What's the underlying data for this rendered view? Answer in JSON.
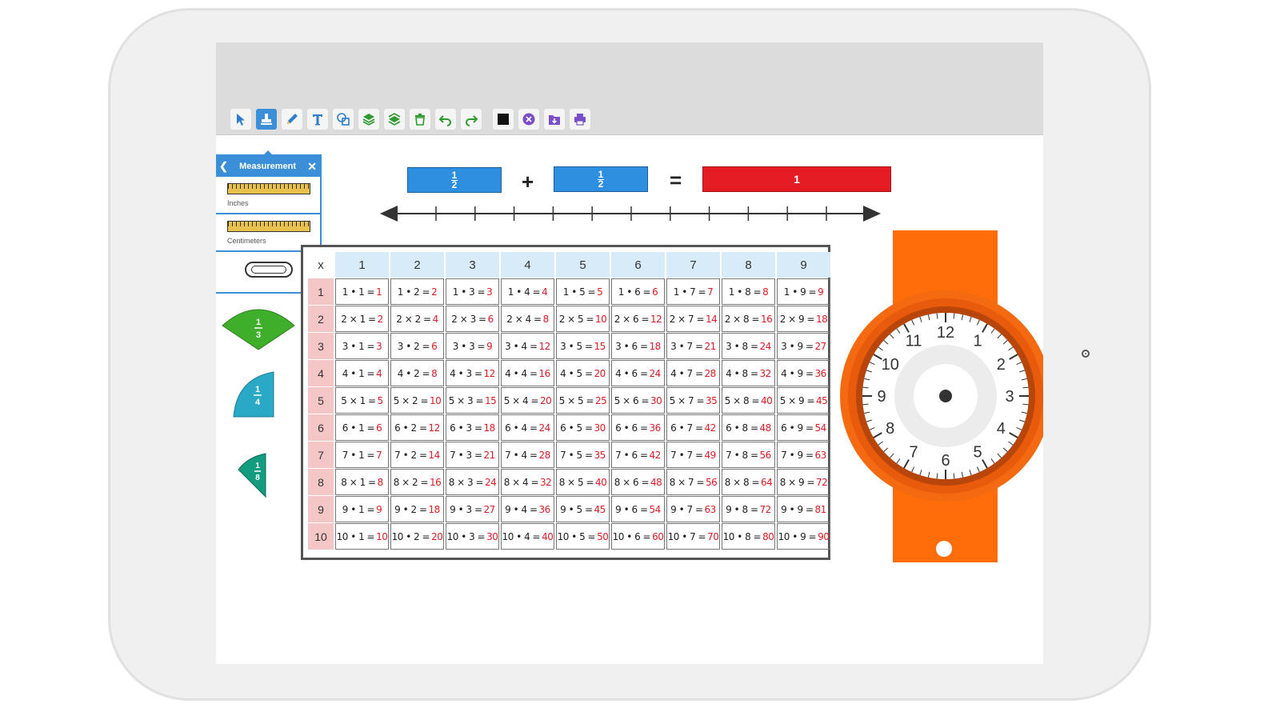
{
  "toolbar": {
    "tools": [
      {
        "name": "select-tool",
        "icon": "pointer-icon"
      },
      {
        "name": "stamp-tool",
        "icon": "stamp-icon",
        "active": true
      },
      {
        "name": "pen-tool",
        "icon": "pencil-icon"
      },
      {
        "name": "text-tool",
        "icon": "text-icon",
        "label": "T"
      },
      {
        "name": "shapes-tool",
        "icon": "shapes-icon"
      },
      {
        "name": "layer-up-tool",
        "icon": "layers-up-icon"
      },
      {
        "name": "layer-down-tool",
        "icon": "layers-down-icon"
      },
      {
        "name": "delete-tool",
        "icon": "trash-icon"
      },
      {
        "name": "undo-tool",
        "icon": "undo-icon"
      },
      {
        "name": "redo-tool",
        "icon": "redo-icon"
      },
      {
        "name": "background-tool",
        "icon": "black-square-icon"
      },
      {
        "name": "clear-tool",
        "icon": "close-circle-icon"
      },
      {
        "name": "save-tool",
        "icon": "save-folder-icon"
      },
      {
        "name": "print-tool",
        "icon": "print-icon"
      }
    ]
  },
  "panel": {
    "title": "Measurement",
    "items": [
      {
        "label": "Inches"
      },
      {
        "label": "Centimeters"
      }
    ]
  },
  "equation": {
    "frac1": {
      "num": "1",
      "den": "2"
    },
    "plus": "+",
    "frac2": {
      "num": "1",
      "den": "2"
    },
    "equals": "=",
    "result": "1"
  },
  "wedges": [
    {
      "num": "1",
      "den": "3",
      "color": "#3fae2a"
    },
    {
      "num": "1",
      "den": "4",
      "color": "#2aa9c6"
    },
    {
      "num": "1",
      "den": "8",
      "color": "#139c7f"
    }
  ],
  "table": {
    "corner": "x",
    "columns": [
      "1",
      "2",
      "3",
      "4",
      "5",
      "6",
      "7",
      "8",
      "9"
    ],
    "rows": [
      "1",
      "2",
      "3",
      "4",
      "5",
      "6",
      "7",
      "8",
      "9",
      "10"
    ],
    "cells": [
      [
        "1 • 1 =",
        "1",
        "1 • 2 =",
        "2",
        "1 • 3 =",
        "3",
        "1 • 4 =",
        "4",
        "1 • 5 =",
        "5",
        "1 • 6 =",
        "6",
        "1 • 7 =",
        "7",
        "1 • 8 =",
        "8",
        "1 • 9 =",
        "9"
      ],
      [
        "2 × 1 =",
        "2",
        "2 × 2 =",
        "4",
        "2 × 3 =",
        "6",
        "2 × 4 =",
        "8",
        "2 × 5 =",
        "10",
        "2 × 6 =",
        "12",
        "2 × 7 =",
        "14",
        "2 × 8 =",
        "16",
        "2 × 9 =",
        "18"
      ],
      [
        "3 • 1 =",
        "3",
        "3 • 2 =",
        "6",
        "3 • 3 =",
        "9",
        "3 • 4 =",
        "12",
        "3 • 5 =",
        "15",
        "3 • 6 =",
        "18",
        "3 • 7 =",
        "21",
        "3 • 8 =",
        "24",
        "3 • 9 =",
        "27"
      ],
      [
        "4 • 1 =",
        "4",
        "4 • 2 =",
        "8",
        "4 • 3 =",
        "12",
        "4 • 4 =",
        "16",
        "4 • 5 =",
        "20",
        "4 • 6 =",
        "24",
        "4 • 7 =",
        "28",
        "4 • 8 =",
        "32",
        "4 • 9 =",
        "36"
      ],
      [
        "5 × 1 =",
        "5",
        "5 × 2 =",
        "10",
        "5 × 3 =",
        "15",
        "5 × 4 =",
        "20",
        "5 × 5 =",
        "25",
        "5 × 6 =",
        "30",
        "5 × 7 =",
        "35",
        "5 × 8 =",
        "40",
        "5 × 9 =",
        "45"
      ],
      [
        "6 • 1 =",
        "6",
        "6 • 2 =",
        "12",
        "6 • 3 =",
        "18",
        "6 • 4 =",
        "24",
        "6 • 5 =",
        "30",
        "6 • 6 =",
        "36",
        "6 • 7 =",
        "42",
        "6 • 8 =",
        "48",
        "6 • 9 =",
        "54"
      ],
      [
        "7 • 1 =",
        "7",
        "7 • 2 =",
        "14",
        "7 • 3 =",
        "21",
        "7 • 4 =",
        "28",
        "7 • 5 =",
        "35",
        "7 • 6 =",
        "42",
        "7 • 7 =",
        "49",
        "7 • 8 =",
        "56",
        "7 • 9 =",
        "63"
      ],
      [
        "8 × 1 =",
        "8",
        "8 × 2 =",
        "16",
        "8 × 3 =",
        "24",
        "8 × 4 =",
        "32",
        "8 × 5 =",
        "40",
        "8 × 6 =",
        "48",
        "8 × 7 =",
        "56",
        "8 × 8 =",
        "64",
        "8 × 9 =",
        "72"
      ],
      [
        "9 • 1 =",
        "9",
        "9 • 2 =",
        "18",
        "9 • 3 =",
        "27",
        "9 • 4 =",
        "36",
        "9 • 5 =",
        "45",
        "9 • 6 =",
        "54",
        "9 • 7 =",
        "63",
        "9 • 8 =",
        "72",
        "9 • 9 =",
        "81"
      ],
      [
        "10 • 1 =",
        "10",
        "10 • 2 =",
        "20",
        "10 • 3 =",
        "30",
        "10 • 4 =",
        "40",
        "10 • 5 =",
        "50",
        "10 • 6 =",
        "60",
        "10 • 7 =",
        "70",
        "10 • 8 =",
        "80",
        "10 • 9 =",
        "90"
      ]
    ]
  },
  "clock": {
    "numbers": [
      "12",
      "1",
      "2",
      "3",
      "4",
      "5",
      "6",
      "7",
      "8",
      "9",
      "10",
      "11"
    ],
    "strap_color": "#ff6c0a",
    "bezel_color": "#e85a0c"
  },
  "colors": {
    "accent": "#3a8fd8",
    "result_red": "#e31b23",
    "equation_blue": "#2e8ee0",
    "equation_red": "#e61c24"
  }
}
